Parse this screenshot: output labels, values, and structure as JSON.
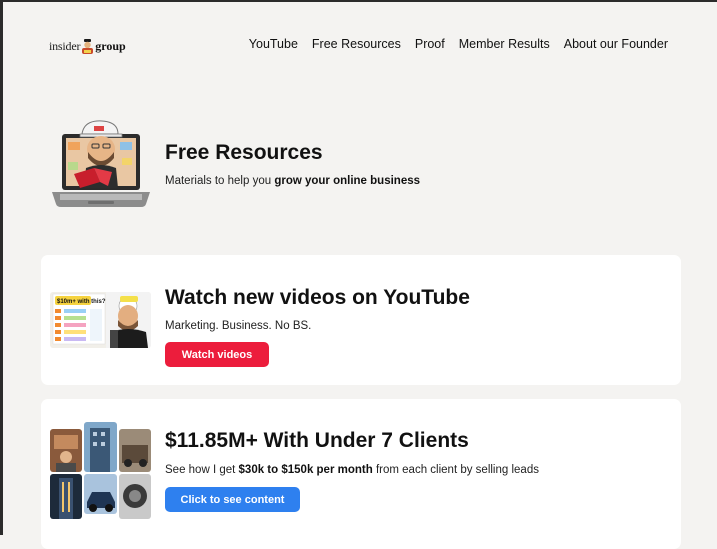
{
  "header": {
    "logo_left": "insider",
    "logo_right": "group",
    "nav": [
      "YouTube",
      "Free Resources",
      "Proof",
      "Member Results",
      "About our Founder"
    ]
  },
  "hero": {
    "title": "Free Resources",
    "subtitle_prefix": "Materials to help you ",
    "subtitle_bold": "grow your online business"
  },
  "cards": [
    {
      "title": "Watch new videos on YouTube",
      "description": "Marketing. Business. No BS.",
      "button": "Watch videos",
      "thumb_text": "$10m+ with this?"
    },
    {
      "title": "$11.85M+ With Under 7 Clients",
      "desc_prefix": "See how I get ",
      "desc_bold": "$30k to $150k per month",
      "desc_suffix": " from each client by selling leads",
      "button": "Click to see content"
    }
  ],
  "colors": {
    "background": "#f4f3f1",
    "card": "#ffffff",
    "button_red": "#ec1d3c",
    "button_blue": "#2e80ef"
  }
}
